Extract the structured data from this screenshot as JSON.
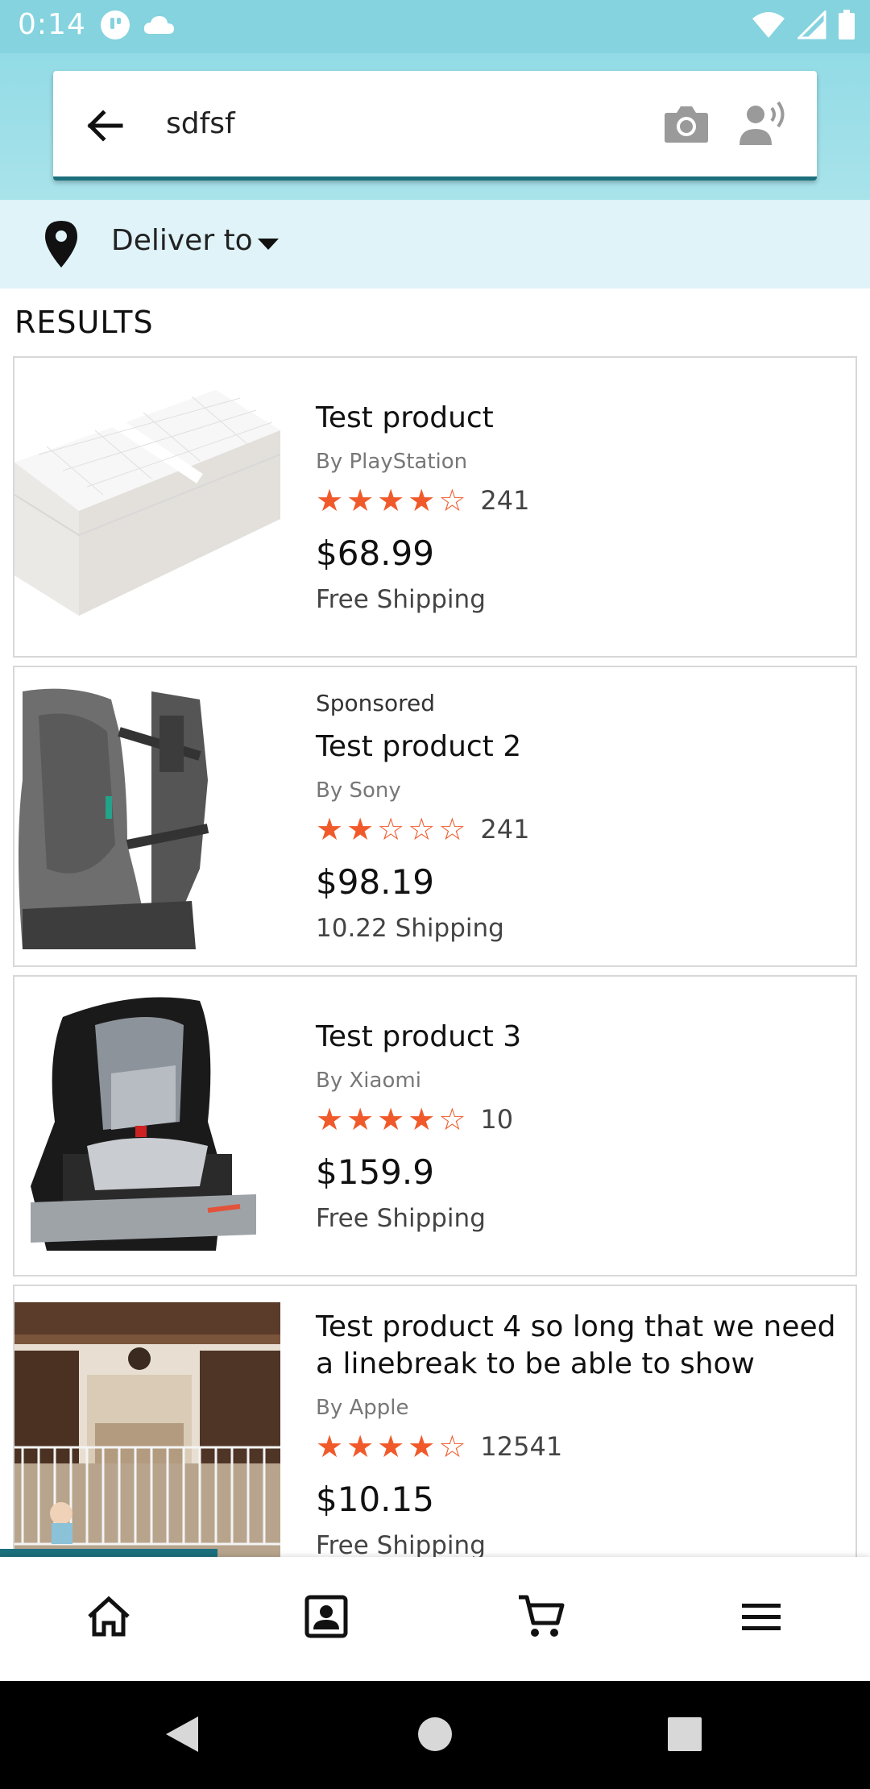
{
  "status_bar": {
    "time": "0:14"
  },
  "search": {
    "query": "sdfsf"
  },
  "deliver": {
    "label": "Deliver to"
  },
  "results": {
    "heading": "RESULTS"
  },
  "products": [
    {
      "sponsored": "",
      "title": "Test product",
      "brand": "By PlayStation",
      "rating": 4,
      "review_count": "241",
      "price": "$68.99",
      "shipping": "Free Shipping",
      "image": "changing-pad"
    },
    {
      "sponsored": "Sponsored",
      "title": "Test product 2",
      "brand": "By Sony",
      "rating": 2,
      "review_count": "241",
      "price": "$98.19",
      "shipping": "10.22 Shipping",
      "image": "baby-carrier"
    },
    {
      "sponsored": "",
      "title": "Test product 3",
      "brand": "By Xiaomi",
      "rating": 4,
      "review_count": "10",
      "price": "$159.9",
      "shipping": "Free Shipping",
      "image": "car-seat"
    },
    {
      "sponsored": "",
      "title": "Test product 4 so long that we need a linebreak to be able to show",
      "brand": "By Apple",
      "rating": 4,
      "review_count": "12541",
      "price": "$10.15",
      "shipping": "Free Shipping",
      "image": "baby-gate-room"
    }
  ],
  "icons": {
    "back": "arrow-left-icon",
    "camera": "camera-icon",
    "voice": "voice-search-icon",
    "location": "location-pin-icon",
    "home": "home-icon",
    "account": "account-icon",
    "cart": "cart-icon",
    "menu": "menu-icon"
  },
  "colors": {
    "header": "#92dbe6",
    "deliver_bar": "#dff3f8",
    "accent": "#1c6f7c",
    "star": "#f05a2b"
  }
}
